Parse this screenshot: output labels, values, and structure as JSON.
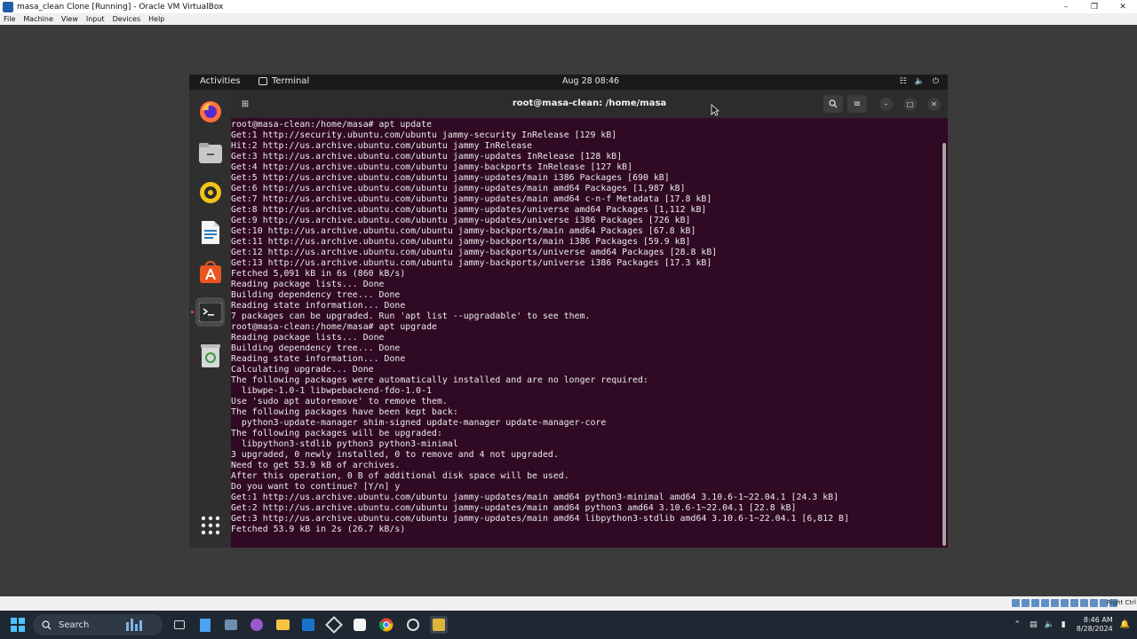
{
  "vbox": {
    "title": "masa_clean Clone [Running] - Oracle VM VirtualBox",
    "menu": [
      "File",
      "Machine",
      "View",
      "Input",
      "Devices",
      "Help"
    ],
    "host_key": "Right Ctrl"
  },
  "ubuntu": {
    "activities": "Activities",
    "app_name": "Terminal",
    "clock": "Aug 28  08:46"
  },
  "dock": {
    "items": [
      "firefox-icon",
      "files-icon",
      "rhythmbox-icon",
      "writer-icon",
      "app-center-icon",
      "terminal-icon",
      "trash-icon",
      "show-apps-icon"
    ]
  },
  "terminal": {
    "title": "root@masa-clean: /home/masa",
    "lines": [
      "root@masa-clean:/home/masa# apt update",
      "Get:1 http://security.ubuntu.com/ubuntu jammy-security InRelease [129 kB]",
      "Hit:2 http://us.archive.ubuntu.com/ubuntu jammy InRelease",
      "Get:3 http://us.archive.ubuntu.com/ubuntu jammy-updates InRelease [128 kB]",
      "Get:4 http://us.archive.ubuntu.com/ubuntu jammy-backports InRelease [127 kB]",
      "Get:5 http://us.archive.ubuntu.com/ubuntu jammy-updates/main i386 Packages [690 kB]",
      "Get:6 http://us.archive.ubuntu.com/ubuntu jammy-updates/main amd64 Packages [1,987 kB]",
      "Get:7 http://us.archive.ubuntu.com/ubuntu jammy-updates/main amd64 c-n-f Metadata [17.8 kB]",
      "Get:8 http://us.archive.ubuntu.com/ubuntu jammy-updates/universe amd64 Packages [1,112 kB]",
      "Get:9 http://us.archive.ubuntu.com/ubuntu jammy-updates/universe i386 Packages [726 kB]",
      "Get:10 http://us.archive.ubuntu.com/ubuntu jammy-backports/main amd64 Packages [67.8 kB]",
      "Get:11 http://us.archive.ubuntu.com/ubuntu jammy-backports/main i386 Packages [59.9 kB]",
      "Get:12 http://us.archive.ubuntu.com/ubuntu jammy-backports/universe amd64 Packages [28.8 kB]",
      "Get:13 http://us.archive.ubuntu.com/ubuntu jammy-backports/universe i386 Packages [17.3 kB]",
      "Fetched 5,091 kB in 6s (860 kB/s)",
      "Reading package lists... Done",
      "Building dependency tree... Done",
      "Reading state information... Done",
      "7 packages can be upgraded. Run 'apt list --upgradable' to see them.",
      "root@masa-clean:/home/masa# apt upgrade",
      "Reading package lists... Done",
      "Building dependency tree... Done",
      "Reading state information... Done",
      "Calculating upgrade... Done",
      "The following packages were automatically installed and are no longer required:",
      "  libwpe-1.0-1 libwpebackend-fdo-1.0-1",
      "Use 'sudo apt autoremove' to remove them.",
      "The following packages have been kept back:",
      "  python3-update-manager shim-signed update-manager update-manager-core",
      "The following packages will be upgraded:",
      "  libpython3-stdlib python3 python3-minimal",
      "3 upgraded, 0 newly installed, 0 to remove and 4 not upgraded.",
      "Need to get 53.9 kB of archives.",
      "After this operation, 0 B of additional disk space will be used.",
      "Do you want to continue? [Y/n] y",
      "Get:1 http://us.archive.ubuntu.com/ubuntu jammy-updates/main amd64 python3-minimal amd64 3.10.6-1~22.04.1 [24.3 kB]",
      "Get:2 http://us.archive.ubuntu.com/ubuntu jammy-updates/main amd64 python3 amd64 3.10.6-1~22.04.1 [22.8 kB]",
      "Get:3 http://us.archive.ubuntu.com/ubuntu jammy-updates/main amd64 libpython3-stdlib amd64 3.10.6-1~22.04.1 [6,812 B]",
      "Fetched 53.9 kB in 2s (26.7 kB/s)"
    ]
  },
  "taskbar": {
    "search_label": "Search",
    "time": "8:46 AM",
    "date": "8/28/2024"
  },
  "colors": {
    "terminal_bg": "#300a24",
    "ubuntu_orange": "#e95420",
    "windows_accent": "#4cc2ff"
  }
}
